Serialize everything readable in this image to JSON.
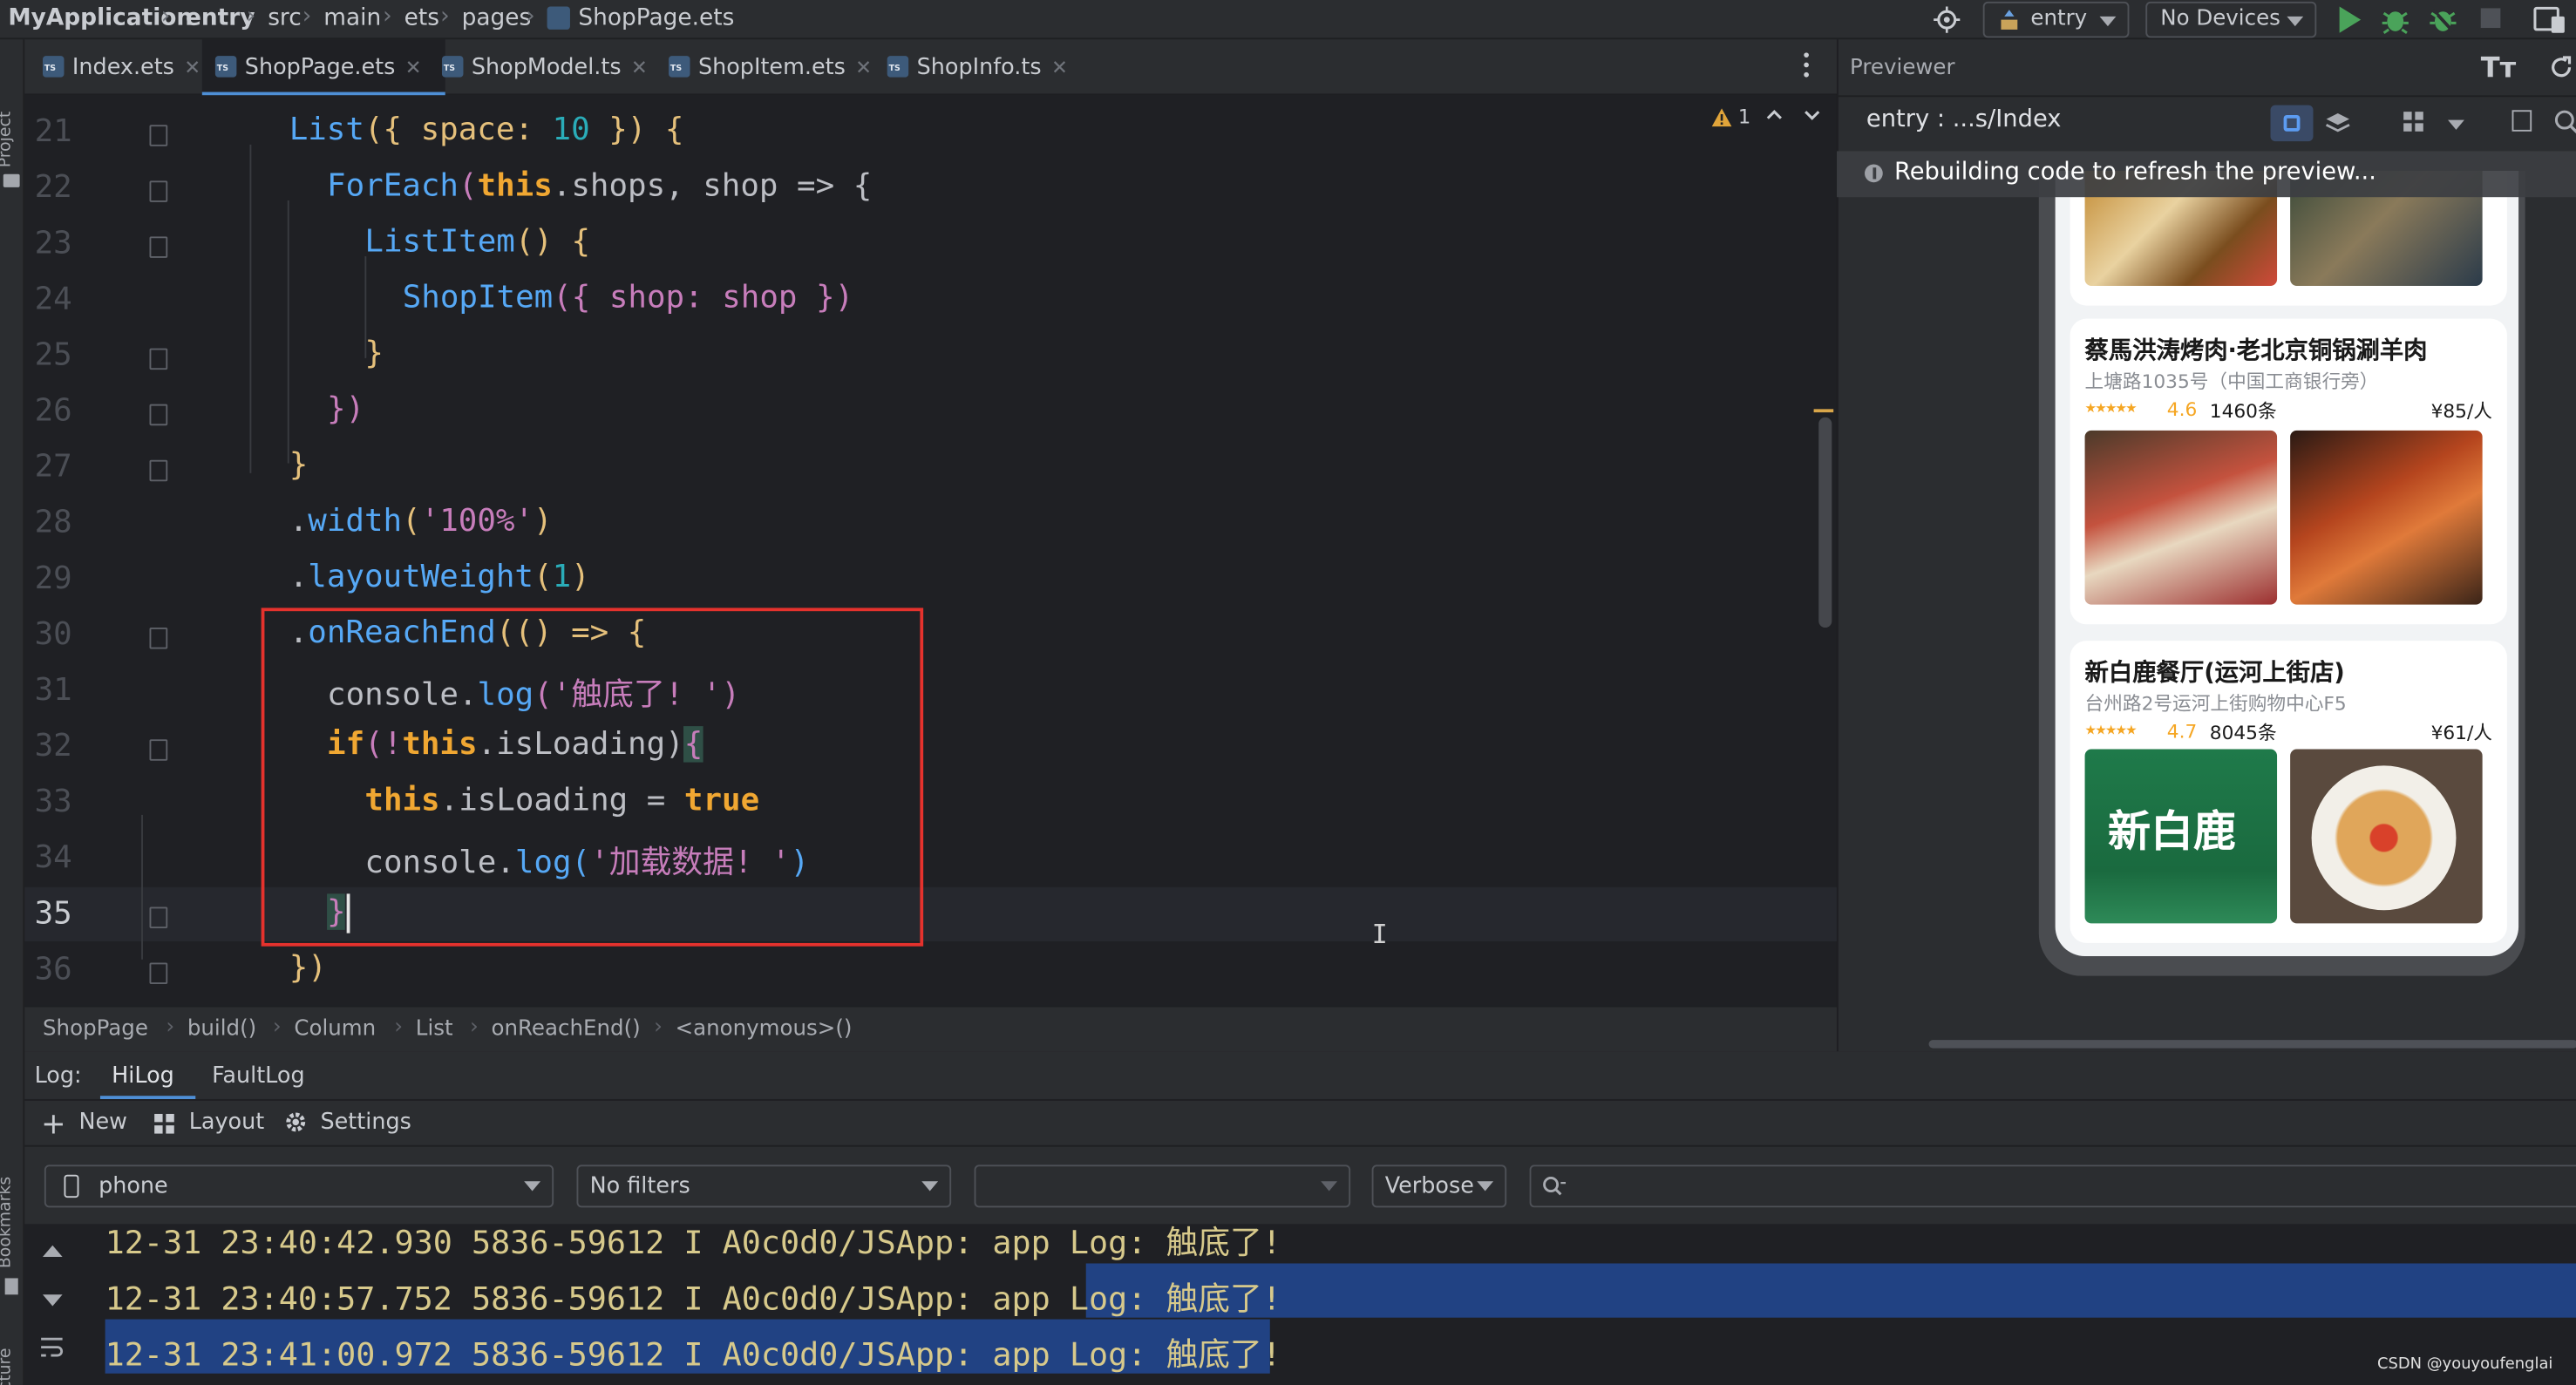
{
  "titlebar": {
    "breadcrumbs": [
      "MyApplication",
      "entry",
      "src",
      "main",
      "ets",
      "pages",
      "ShopPage.ets"
    ],
    "module_select": "entry",
    "device_select": "No Devices"
  },
  "side_tools": {
    "project": "Project",
    "bookmarks": "Bookmarks",
    "structure": "Structure"
  },
  "tabs": [
    {
      "label": "Index.ets",
      "active": false
    },
    {
      "label": "ShopPage.ets",
      "active": true
    },
    {
      "label": "ShopModel.ts",
      "active": false
    },
    {
      "label": "ShopItem.ets",
      "active": false
    },
    {
      "label": "ShopInfo.ts",
      "active": false
    }
  ],
  "editor": {
    "line_numbers": [
      "21",
      "22",
      "23",
      "24",
      "25",
      "26",
      "27",
      "28",
      "29",
      "30",
      "31",
      "32",
      "33",
      "34",
      "35",
      "36"
    ],
    "current_line": "35",
    "warning_count": "1",
    "code": {
      "l21": {
        "a": "List",
        "b": "({ space: ",
        "c": "10",
        "d": " }) {"
      },
      "l22": {
        "a": "ForEach",
        "b": "(",
        "c": "this",
        "d": ".shops, shop => {"
      },
      "l23": {
        "a": "ListItem",
        "b": "() {"
      },
      "l24": {
        "a": "ShopItem",
        "b": "({ shop: shop })"
      },
      "l25": {
        "a": "}"
      },
      "l26": {
        "a": "})"
      },
      "l27": {
        "a": "}"
      },
      "l28": {
        "a": ".",
        "b": "width",
        "c": "(",
        "d": "'100%'",
        "e": ")"
      },
      "l29": {
        "a": ".",
        "b": "layoutWeight",
        "c": "(",
        "d": "1",
        "e": ")"
      },
      "l30": {
        "a": ".",
        "b": "onReachEnd",
        "c": "(() => {"
      },
      "l31": {
        "a": "console.",
        "b": "log",
        "c": "(",
        "d": "'触底了! '",
        "e": ")"
      },
      "l32": {
        "a": "if",
        "b": "(!",
        "c": "this",
        "d": ".isLoading)",
        "e": "{"
      },
      "l33": {
        "a": "this",
        "b": ".isLoading = ",
        "c": "true"
      },
      "l34": {
        "a": "console.",
        "b": "log",
        "c": "(",
        "d": "'加载数据! '",
        "e": ")"
      },
      "l35": {
        "a": "}"
      },
      "l36": {
        "a": "})"
      }
    }
  },
  "code_breadcrumb": [
    "ShopPage",
    "build()",
    "Column",
    "List",
    "onReachEnd()",
    "<anonymous>()"
  ],
  "previewer": {
    "title": "Previewer",
    "page_path": "entry : ...s/Index",
    "notice": "Rebuilding code to refresh the preview...",
    "shops": [
      {
        "name": "蔡馬洪涛烤肉·老北京铜锅涮羊肉",
        "address": "上塘路1035号（中国工商银行旁）",
        "rating": "4.6",
        "count": "1460条",
        "price": "¥85/人"
      },
      {
        "name": "新白鹿餐厅(运河上街店)",
        "address": "台州路2号运河上街购物中心F5",
        "rating": "4.7",
        "count": "8045条",
        "price": "¥61/人"
      }
    ],
    "logo_text": "新白鹿"
  },
  "log": {
    "label": "Log:",
    "tabs": [
      "HiLog",
      "FaultLog"
    ],
    "toolbar": {
      "new": "New",
      "layout": "Layout",
      "settings": "Settings"
    },
    "filters": {
      "device": "phone",
      "filter": "No filters",
      "process": "",
      "level": "Verbose",
      "search_placeholder": ""
    },
    "lines": [
      "12-31 23:40:42.930 5836-59612 I A0c0d0/JSApp: app Log: 触底了!",
      "12-31 23:40:57.752 5836-59612 I A0c0d0/JSApp: app Log: 触底了!",
      "12-31 23:41:00.972 5836-59612 I A0c0d0/JSApp: app Log: 触底了!"
    ]
  },
  "watermark": "CSDN @youyoufenglai",
  "colors": {
    "accent": "#4e8fd6",
    "highlight_box": "#e5322d",
    "selection": "#214283",
    "run": "#499c54"
  }
}
